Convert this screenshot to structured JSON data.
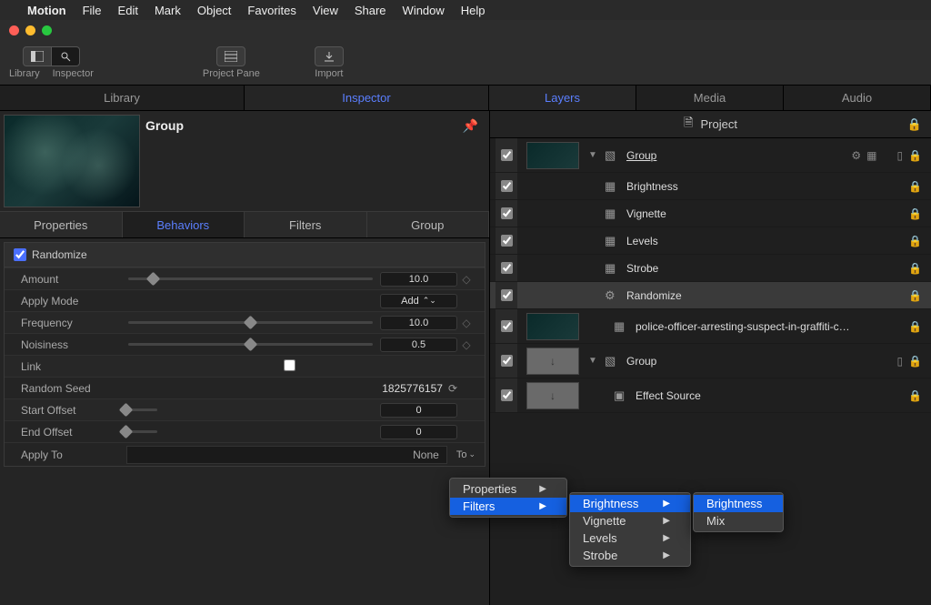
{
  "menubar": {
    "apple": "",
    "app": "Motion",
    "items": [
      "File",
      "Edit",
      "Mark",
      "Object",
      "Favorites",
      "View",
      "Share",
      "Window",
      "Help"
    ]
  },
  "toolbar": {
    "library": "Library",
    "inspector": "Inspector",
    "project_pane": "Project Pane",
    "import": "Import"
  },
  "left_tabs": {
    "library": "Library",
    "inspector": "Inspector"
  },
  "preview": {
    "title": "Group"
  },
  "sub_tabs": {
    "properties": "Properties",
    "behaviors": "Behaviors",
    "filters": "Filters",
    "group": "Group"
  },
  "behavior": {
    "name": "Randomize",
    "params": {
      "amount": {
        "label": "Amount",
        "value": "10.0"
      },
      "apply_mode": {
        "label": "Apply Mode",
        "value": "Add"
      },
      "frequency": {
        "label": "Frequency",
        "value": "10.0"
      },
      "noisiness": {
        "label": "Noisiness",
        "value": "0.5"
      },
      "link": {
        "label": "Link"
      },
      "random_seed": {
        "label": "Random Seed",
        "value": "1825776157"
      },
      "start_offset": {
        "label": "Start Offset",
        "value": "0"
      },
      "end_offset": {
        "label": "End Offset",
        "value": "0"
      },
      "apply_to": {
        "label": "Apply To",
        "value": "None",
        "to": "To"
      }
    }
  },
  "right_tabs": {
    "layers": "Layers",
    "media": "Media",
    "audio": "Audio"
  },
  "project_header": "Project",
  "layers": [
    {
      "name": "Group",
      "type": "group",
      "underline": true
    },
    {
      "name": "Brightness",
      "type": "filter"
    },
    {
      "name": "Vignette",
      "type": "filter"
    },
    {
      "name": "Levels",
      "type": "filter"
    },
    {
      "name": "Strobe",
      "type": "filter"
    },
    {
      "name": "Randomize",
      "type": "behavior",
      "selected": true
    },
    {
      "name": "police-officer-arresting-suspect-in-graffiti-c…",
      "type": "clip"
    },
    {
      "name": "Group",
      "type": "group2"
    },
    {
      "name": "Effect Source",
      "type": "source"
    }
  ],
  "ctx1": [
    {
      "label": "Properties",
      "arrow": true
    },
    {
      "label": "Filters",
      "arrow": true,
      "hl": true
    }
  ],
  "ctx2": [
    {
      "label": "Brightness",
      "arrow": true,
      "hl": true
    },
    {
      "label": "Vignette",
      "arrow": true
    },
    {
      "label": "Levels",
      "arrow": true
    },
    {
      "label": "Strobe",
      "arrow": true
    }
  ],
  "ctx3": [
    {
      "label": "Brightness",
      "hl": true
    },
    {
      "label": "Mix"
    }
  ]
}
